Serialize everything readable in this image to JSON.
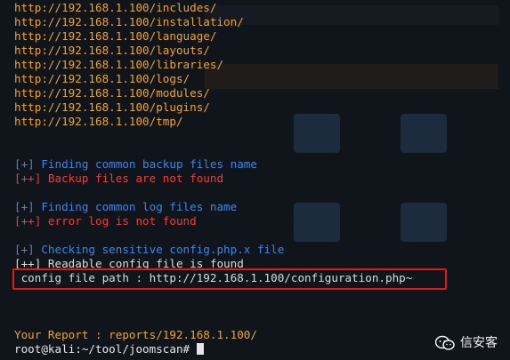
{
  "terminal": {
    "lines": [
      {
        "text": "http://192.168.1.100/includes/",
        "color": "orange"
      },
      {
        "text": "http://192.168.1.100/installation/",
        "color": "orange"
      },
      {
        "text": "http://192.168.1.100/language/",
        "color": "orange"
      },
      {
        "text": "http://192.168.1.100/layouts/",
        "color": "orange"
      },
      {
        "text": "http://192.168.1.100/libraries/",
        "color": "orange"
      },
      {
        "text": "http://192.168.1.100/logs/",
        "color": "orange"
      },
      {
        "text": "http://192.168.1.100/modules/",
        "color": "orange"
      },
      {
        "text": "http://192.168.1.100/plugins/",
        "color": "orange"
      },
      {
        "text": "http://192.168.1.100/tmp/",
        "color": "orange"
      },
      {
        "text": "",
        "color": "white"
      },
      {
        "text": "",
        "color": "white"
      },
      {
        "text": "[+] Finding common backup files name",
        "color": "blue"
      },
      {
        "text": "[++] Backup files are not found",
        "color": "red"
      },
      {
        "text": "",
        "color": "white"
      },
      {
        "text": "[+] Finding common log files name",
        "color": "blue"
      },
      {
        "text": "[++] error log is not found",
        "color": "red"
      },
      {
        "text": "",
        "color": "white"
      },
      {
        "text": "[+] Checking sensitive config.php.x file",
        "color": "blue"
      },
      {
        "text": "[++] Readable config file is found",
        "color": "white"
      },
      {
        "text": " config file path : http://192.168.1.100/configuration.php~",
        "color": "white"
      },
      {
        "text": "",
        "color": "white"
      },
      {
        "text": "",
        "color": "white"
      },
      {
        "text": "",
        "color": "white"
      },
      {
        "text": "Your Report : reports/192.168.1.100/",
        "color": "orange"
      }
    ],
    "prompt": "root@kali:~/tool/joomscan# "
  },
  "watermark": {
    "text": "信安客"
  },
  "colors": {
    "orange": "#e9a63a",
    "blue": "#3f86e0",
    "red": "#e8413f",
    "white": "#d9dde3",
    "highlight_border": "#e01b1b"
  }
}
